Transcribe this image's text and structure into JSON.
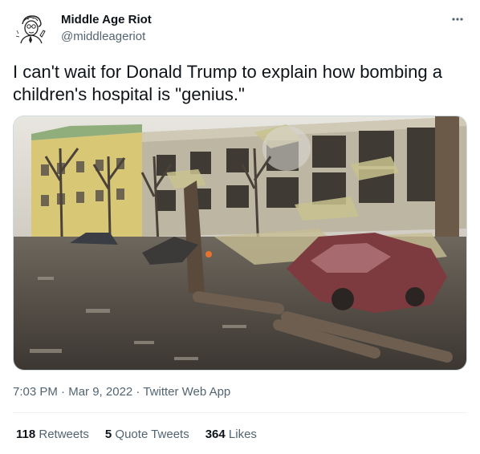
{
  "author": {
    "name": "Middle Age Riot",
    "handle": "@middleageriot",
    "avatar_icon": "sketch-portrait-icon"
  },
  "more_icon": "more-horizontal-icon",
  "tweet": {
    "text": "I can't wait for Donald Trump to explain how bombing a children's hospital is \"genius.\""
  },
  "media": {
    "type": "photo"
  },
  "meta": {
    "time": "7:03 PM",
    "sep1": " · ",
    "date": "Mar 9, 2022",
    "sep2": " · ",
    "source": "Twitter Web App"
  },
  "stats": {
    "retweets_count": "118",
    "retweets_label": "Retweets",
    "quotes_count": "5",
    "quotes_label": "Quote Tweets",
    "likes_count": "364",
    "likes_label": "Likes"
  },
  "colors": {
    "text_primary": "#0f1419",
    "text_secondary": "#536471",
    "border": "#cfd9de",
    "divider": "#eff3f4"
  }
}
